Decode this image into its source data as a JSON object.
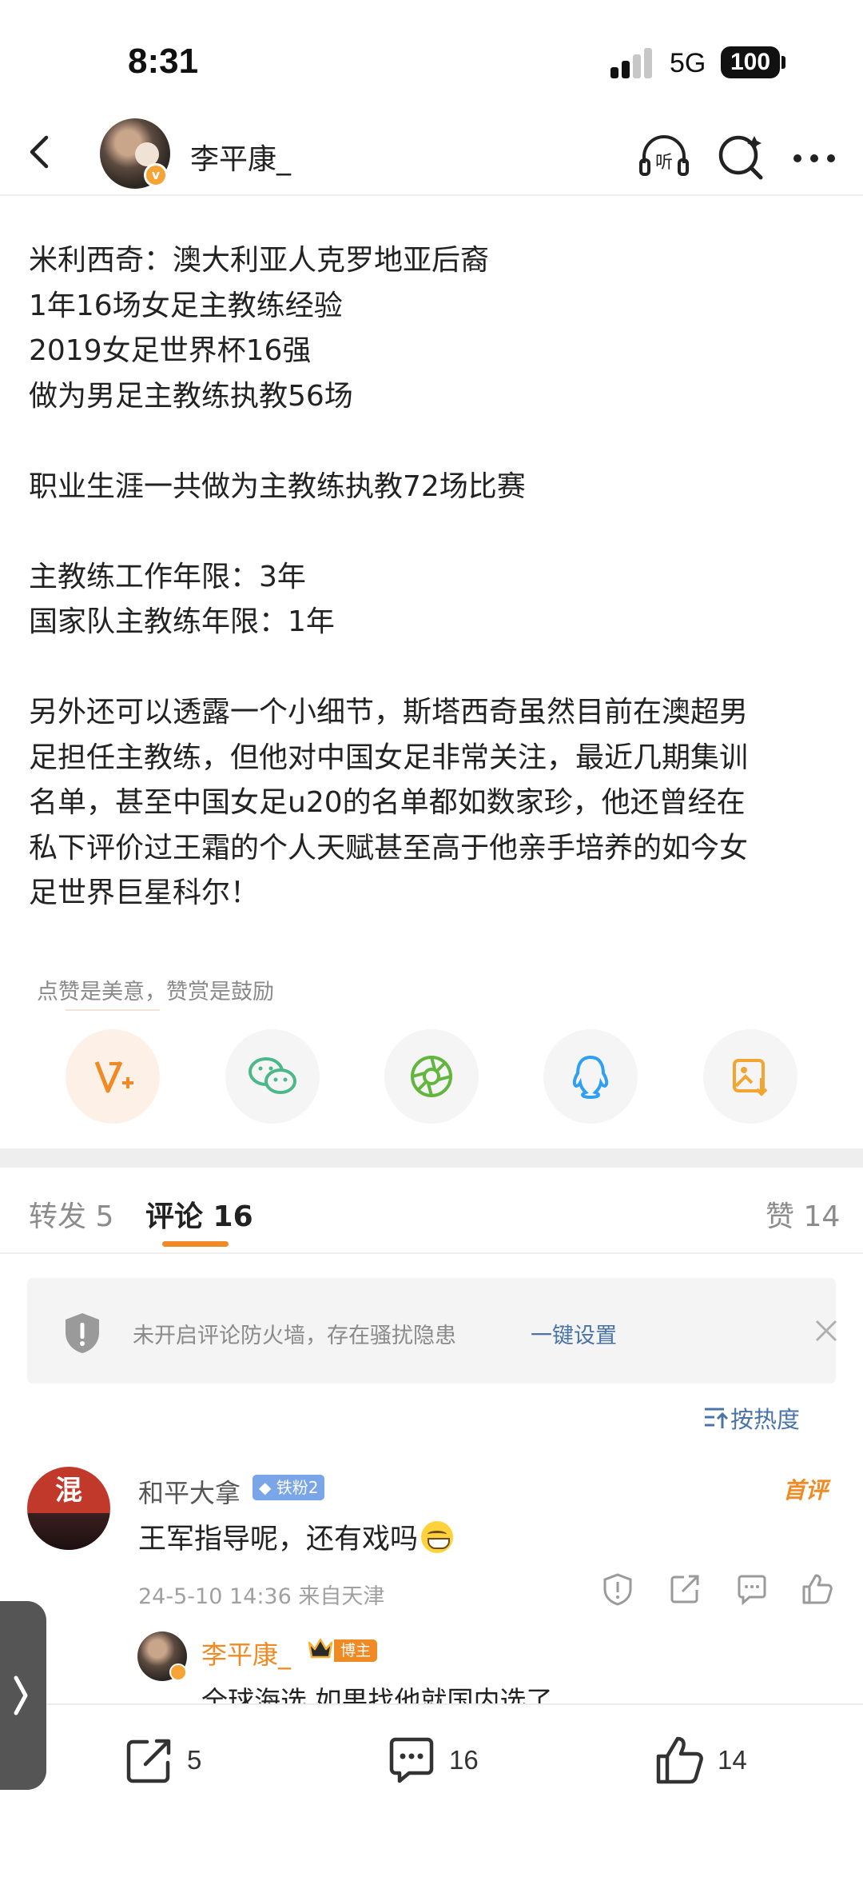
{
  "status_bar": {
    "time": "8:31",
    "network": "5G",
    "battery": "100"
  },
  "header": {
    "author_name": "李平康_"
  },
  "article": {
    "lines": [
      "米利西奇：澳大利亚人克罗地亚后裔",
      "1年16场女足主教练经验",
      "2019女足世界杯16强",
      "做为男足主教练执教56场",
      "",
      "职业生涯一共做为主教练执教72场比赛",
      "",
      "主教练工作年限：3年",
      "国家队主教练年限：1年",
      "",
      "另外还可以透露一个小细节，斯塔西奇虽然目前在澳超男",
      "足担任主教练，但他对中国女足非常关注，最近几期集训",
      "名单，甚至中国女足u20的名单都如数家珍，他还曾经在",
      "私下评价过王霜的个人天赋甚至高于他亲手培养的如今女",
      "足世界巨星科尔！"
    ]
  },
  "reward": {
    "text": "点赞是美意，赞赏是鼓励"
  },
  "tabs": {
    "repost": "转发 5",
    "comments": "评论 16",
    "likes": "赞 14"
  },
  "notice": {
    "text": "未开启评论防火墙，存在骚扰隐患",
    "link": "一键设置"
  },
  "sort": {
    "label": "按热度"
  },
  "comment": {
    "avatar_char": "混",
    "user": "和平大拿",
    "fan_badge": "铁粉2",
    "first_badge": "首评",
    "text": "王军指导呢，还有戏吗",
    "meta": "24-5-10 14:36 来自天津"
  },
  "reply": {
    "user": "李平康_",
    "badge": "博主",
    "text": "全球海选 如果找他就国内选了"
  },
  "bottom_bar": {
    "repost_count": "5",
    "comment_count": "16",
    "like_count": "14"
  },
  "colors": {
    "accent": "#f08a25",
    "link": "#4a74a8",
    "text": "#222222",
    "secondary": "#8a8a8a"
  }
}
